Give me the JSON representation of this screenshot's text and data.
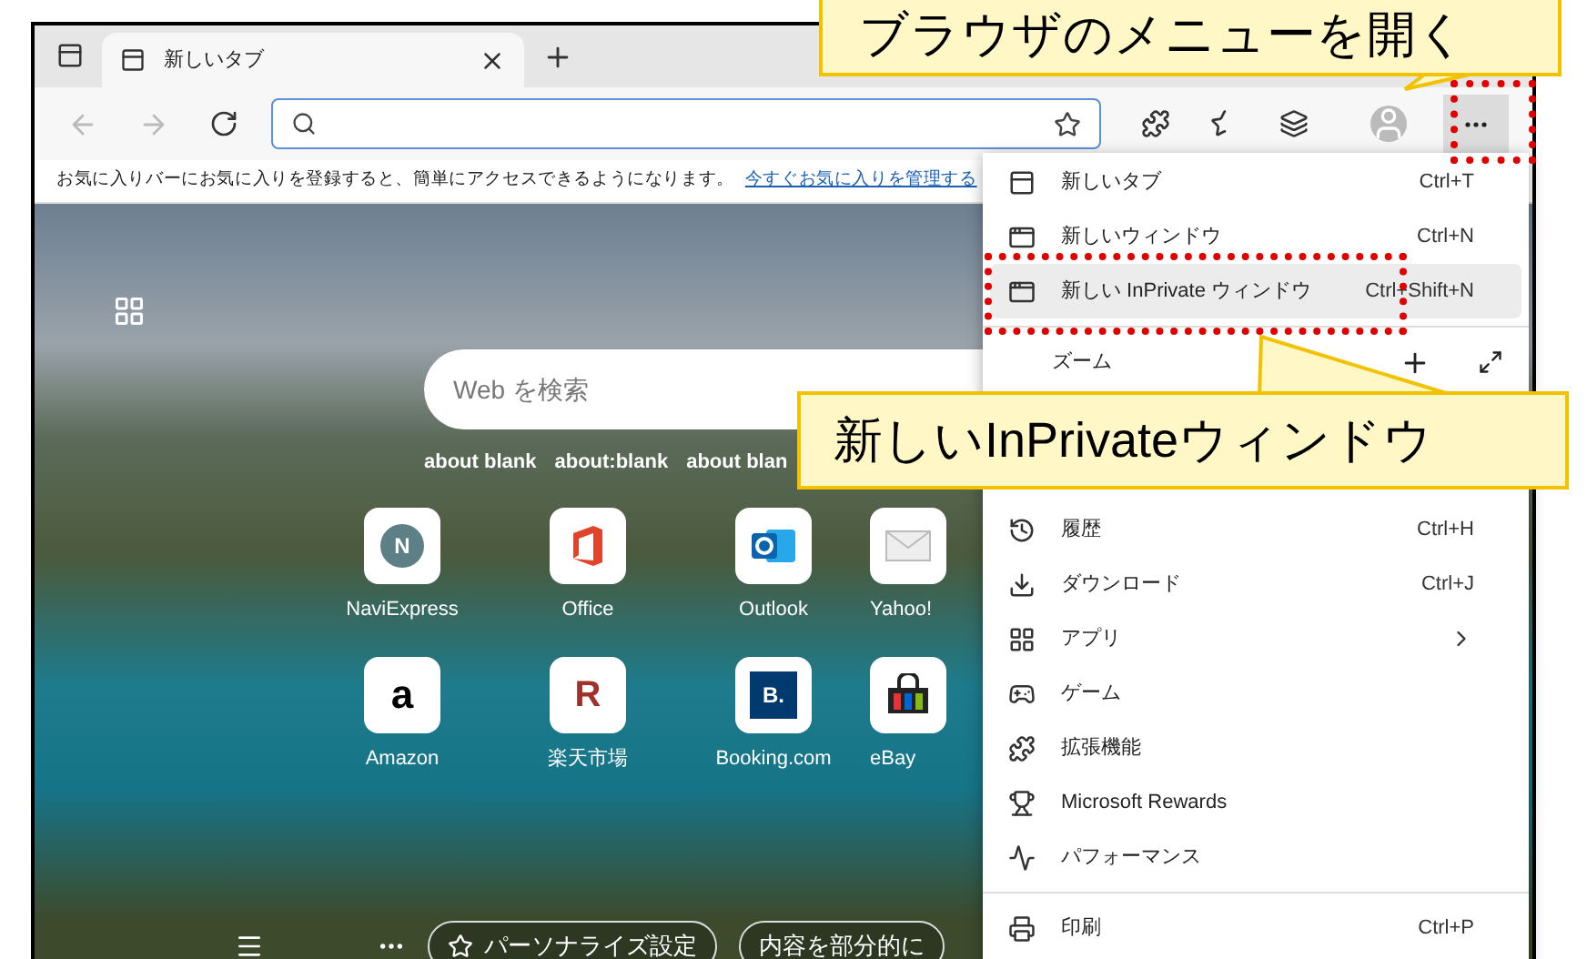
{
  "tabs": [
    {
      "title": "新しいタブ",
      "selected": true
    }
  ],
  "favorites_bar": {
    "message": "お気に入りバーにお気に入りを登録すると、簡単にアクセスできるようになります。",
    "link": "今すぐお気に入りを管理する"
  },
  "new_tab_page": {
    "search_placeholder": "Web を検索",
    "quick_links": [
      "about blank",
      "about:blank",
      "about blan"
    ],
    "tiles": [
      {
        "label": "NaviExpress",
        "kind": "letter",
        "glyph": "N"
      },
      {
        "label": "Office",
        "kind": "office"
      },
      {
        "label": "Outlook",
        "kind": "outlook"
      },
      {
        "label": "Yahoo!",
        "kind": "mail"
      },
      {
        "label": "Amazon",
        "kind": "amazon",
        "glyph": "a"
      },
      {
        "label": "楽天市場",
        "kind": "rakuten",
        "glyph": "R"
      },
      {
        "label": "Booking.com",
        "kind": "booking",
        "glyph": "B."
      },
      {
        "label": "eBay",
        "kind": "bag"
      }
    ],
    "bottom_buttons": [
      "パーソナライズ設定",
      "内容を部分的に"
    ]
  },
  "menu": {
    "items": [
      {
        "kind": "command",
        "label": "新しいタブ",
        "shortcut": "Ctrl+T",
        "selected": false,
        "submenu": false
      },
      {
        "kind": "command",
        "label": "新しいウィンドウ",
        "shortcut": "Ctrl+N",
        "selected": false,
        "submenu": false
      },
      {
        "kind": "command",
        "label": "新しい InPrivate ウィンドウ",
        "shortcut": "Ctrl+Shift+N",
        "selected": true,
        "submenu": false
      },
      {
        "kind": "zoom",
        "label": "ズーム"
      },
      {
        "kind": "command",
        "label": "履歴",
        "shortcut": "Ctrl+H",
        "selected": false,
        "submenu": false
      },
      {
        "kind": "command",
        "label": "ダウンロード",
        "shortcut": "Ctrl+J",
        "selected": false,
        "submenu": false
      },
      {
        "kind": "command",
        "label": "アプリ",
        "selected": false,
        "submenu": true
      },
      {
        "kind": "command",
        "label": "ゲーム",
        "selected": false,
        "submenu": false
      },
      {
        "kind": "command",
        "label": "拡張機能",
        "selected": false,
        "submenu": false
      },
      {
        "kind": "command",
        "label": "Microsoft Rewards",
        "selected": false,
        "submenu": false
      },
      {
        "kind": "command",
        "label": "パフォーマンス",
        "selected": false,
        "submenu": false
      },
      {
        "kind": "divider"
      },
      {
        "kind": "command",
        "label": "印刷",
        "shortcut": "Ctrl+P",
        "selected": false,
        "submenu": false
      }
    ]
  },
  "annotations": [
    {
      "text": "ブラウザのメニューを開く"
    },
    {
      "text": "新しいInPrivateウィンドウ"
    }
  ]
}
